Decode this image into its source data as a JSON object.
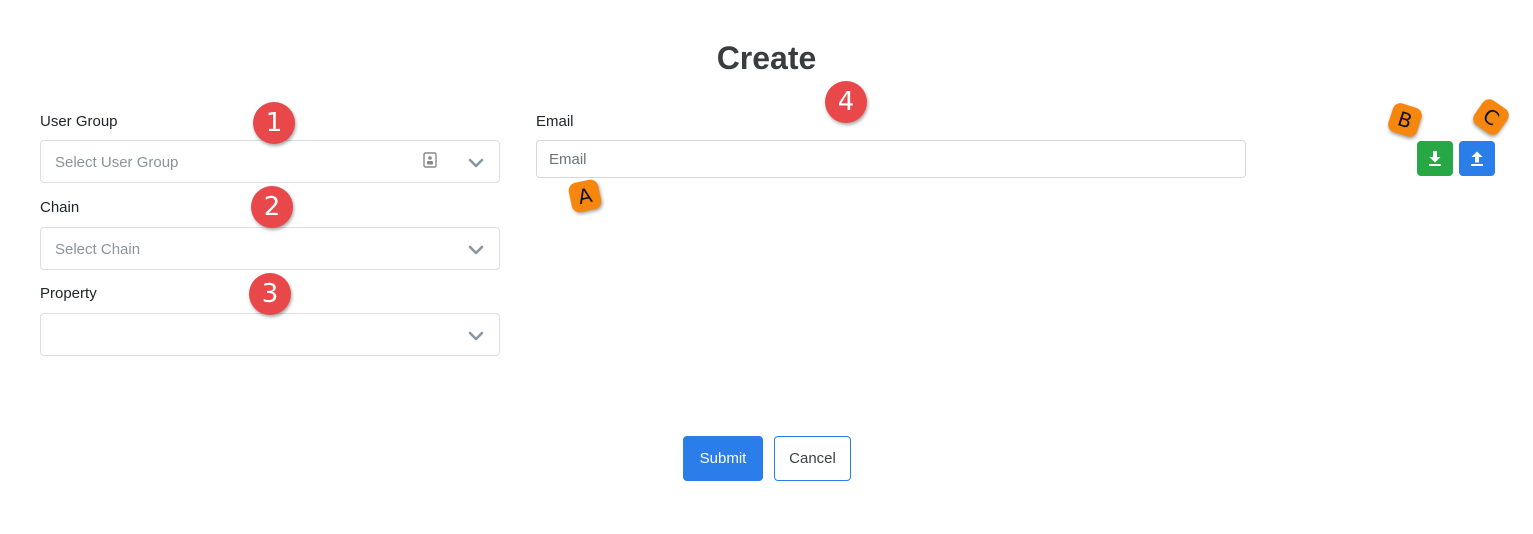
{
  "page": {
    "title": "Create"
  },
  "form": {
    "user_group": {
      "label": "User Group",
      "placeholder": "Select User Group"
    },
    "chain": {
      "label": "Chain",
      "placeholder": "Select Chain"
    },
    "property": {
      "label": "Property",
      "placeholder": ""
    },
    "email": {
      "label": "Email",
      "placeholder": "Email"
    }
  },
  "actions": {
    "submit_label": "Submit",
    "cancel_label": "Cancel"
  },
  "toolbar": {
    "download_icon": "download-icon",
    "upload_icon": "upload-icon"
  },
  "annotations": {
    "markers": [
      "1",
      "2",
      "3",
      "4"
    ],
    "tags": [
      "A",
      "B",
      "C"
    ]
  },
  "colors": {
    "primary": "#2b7de9",
    "success": "#28a745",
    "marker": "#e8484a",
    "tag": "#f5870f"
  }
}
